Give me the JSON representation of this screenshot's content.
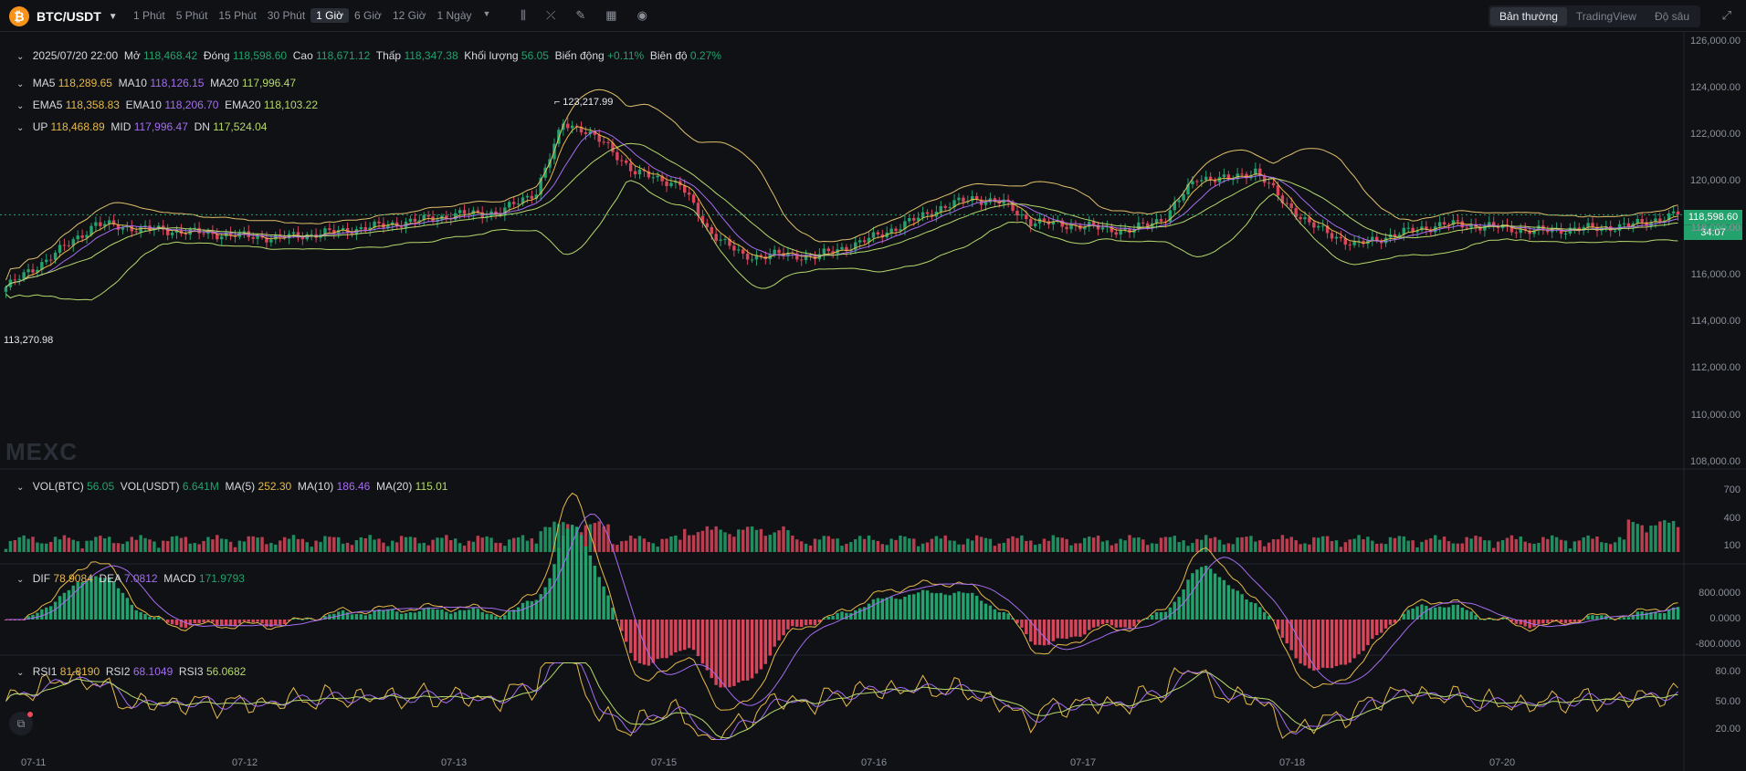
{
  "toolbar": {
    "symbol": "BTC/USDT",
    "coin_glyph": "₿",
    "intervals": [
      "1 Phút",
      "5 Phút",
      "15 Phút",
      "30 Phút",
      "1 Giờ",
      "6 Giờ",
      "12 Giờ",
      "1 Ngày"
    ],
    "active_interval": "1 Giờ",
    "views": [
      "Bản thường",
      "TradingView",
      "Độ sâu"
    ],
    "active_view": "Bản thường"
  },
  "ohlc": {
    "time": "2025/07/20 22:00",
    "open_label": "Mở",
    "open": "118,468.42",
    "close_label": "Đóng",
    "close": "118,598.60",
    "high_label": "Cao",
    "high": "118,671.12",
    "low_label": "Thấp",
    "low": "118,347.38",
    "vol_label": "Khối lượng",
    "vol": "56.05",
    "change_label": "Biến động",
    "change": "+0.11%",
    "amp_label": "Biên độ",
    "amp": "0.27%"
  },
  "ma": {
    "ma5_label": "MA5",
    "ma5": "118,289.65",
    "ma10_label": "MA10",
    "ma10": "118,126.15",
    "ma20_label": "MA20",
    "ma20": "117,996.47"
  },
  "ema": {
    "ema5_label": "EMA5",
    "ema5": "118,358.83",
    "ema10_label": "EMA10",
    "ema10": "118,206.70",
    "ema20_label": "EMA20",
    "ema20": "118,103.22"
  },
  "boll": {
    "up_label": "UP",
    "up": "118,468.89",
    "mid_label": "MID",
    "mid": "117,996.47",
    "dn_label": "DN",
    "dn": "117,524.04"
  },
  "vol": {
    "btc_label": "VOL(BTC)",
    "btc": "56.05",
    "usdt_label": "VOL(USDT)",
    "usdt": "6.641M",
    "ma5_label": "MA(5)",
    "ma5": "252.30",
    "ma10_label": "MA(10)",
    "ma10": "186.46",
    "ma20_label": "MA(20)",
    "ma20": "115.01"
  },
  "macd": {
    "dif_label": "DIF",
    "dif": "78.9084",
    "dea_label": "DEA",
    "dea": "7.0812",
    "macd_label": "MACD",
    "macd": "171.9793"
  },
  "rsi": {
    "rsi1_label": "RSI1",
    "rsi1": "81.8190",
    "rsi2_label": "RSI2",
    "rsi2": "68.1049",
    "rsi3_label": "RSI3",
    "rsi3": "56.0682"
  },
  "watermark": "MEXC",
  "price_box": {
    "price": "118,598.60",
    "countdown": "34:07"
  },
  "colors": {
    "up": "#23a26d",
    "down": "#d8465b",
    "ma5": "#e8b949",
    "ma10": "#a66df0",
    "ma20": "#b6d96b",
    "boll": "#e0c06a"
  },
  "chart_data": {
    "type": "candlestick",
    "x_ticks": [
      "07-11",
      "07-12",
      "07-13",
      "07-15",
      "07-16",
      "07-17",
      "07-18",
      "07-20"
    ],
    "y_ticks": [
      "126,000.00",
      "124,000.00",
      "122,000.00",
      "120,000.00",
      "118,000.00",
      "116,000.00",
      "114,000.00",
      "112,000.00",
      "110,000.00",
      "108,000.00"
    ],
    "ylim": [
      107800,
      126300
    ],
    "annotations": {
      "high": "123,217.99",
      "low": "113,270.98"
    },
    "close_keypoints": [
      [
        0,
        115500
      ],
      [
        10,
        116800
      ],
      [
        20,
        118200
      ],
      [
        30,
        118000
      ],
      [
        45,
        117800
      ],
      [
        60,
        117600
      ],
      [
        75,
        117900
      ],
      [
        90,
        118300
      ],
      [
        100,
        118600
      ],
      [
        110,
        118700
      ],
      [
        118,
        119600
      ],
      [
        124,
        122500
      ],
      [
        128,
        122300
      ],
      [
        134,
        121500
      ],
      [
        140,
        120400
      ],
      [
        150,
        119900
      ],
      [
        156,
        118000
      ],
      [
        164,
        116800
      ],
      [
        172,
        116900
      ],
      [
        180,
        116800
      ],
      [
        190,
        117400
      ],
      [
        200,
        118200
      ],
      [
        208,
        118900
      ],
      [
        215,
        119300
      ],
      [
        222,
        119100
      ],
      [
        228,
        118300
      ],
      [
        240,
        118100
      ],
      [
        250,
        117900
      ],
      [
        258,
        118500
      ],
      [
        265,
        120200
      ],
      [
        272,
        120100
      ],
      [
        278,
        120500
      ],
      [
        284,
        119200
      ],
      [
        290,
        118200
      ],
      [
        300,
        117300
      ],
      [
        310,
        117800
      ],
      [
        320,
        118200
      ],
      [
        330,
        118100
      ],
      [
        340,
        117900
      ],
      [
        350,
        118000
      ],
      [
        360,
        118100
      ],
      [
        372,
        118598
      ]
    ],
    "volume_ticks": [
      "700",
      "400",
      "100"
    ],
    "macd_ticks": [
      "800.0000",
      "0.0000",
      "-800.0000"
    ],
    "rsi_ticks": [
      "80.00",
      "50.00",
      "20.00"
    ]
  }
}
